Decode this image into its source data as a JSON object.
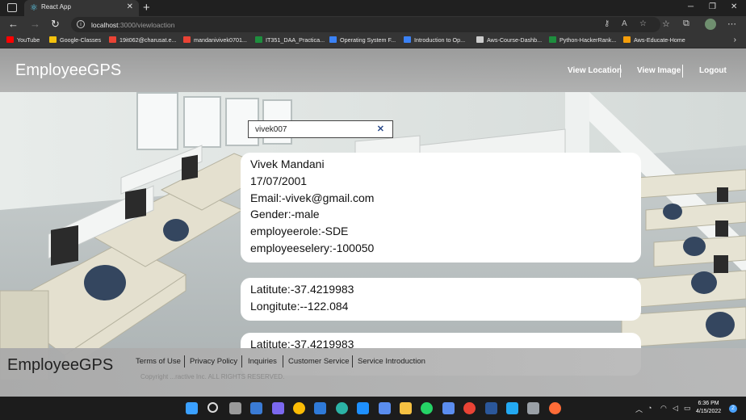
{
  "browser": {
    "tab_title": "React App",
    "url_host": "localhost",
    "url_path": ":3000/viewloaction",
    "bookmarks": [
      {
        "label": "YouTube",
        "color": "#ff0000"
      },
      {
        "label": "Google-Classes",
        "color": "#f4c20d"
      },
      {
        "label": "19it062@charusat.e...",
        "color": "#ea4335"
      },
      {
        "label": "mandanivivek0701...",
        "color": "#ea4335"
      },
      {
        "label": "IT351_DAA_Practica...",
        "color": "#1e8e3e"
      },
      {
        "label": "Operating System F...",
        "color": "#3b82f6"
      },
      {
        "label": "Introduction to Op...",
        "color": "#3b82f6"
      },
      {
        "label": "Aws-Course-Dashb...",
        "color": "#cccccc"
      },
      {
        "label": "Python-HackerRank...",
        "color": "#1e8e3e"
      },
      {
        "label": "Aws-Educate-Home",
        "color": "#f59e0b"
      }
    ]
  },
  "header": {
    "brand": "EmployeeGPS",
    "nav": [
      "View Location",
      "View Image",
      "Logout"
    ]
  },
  "search": {
    "value": "vivek007"
  },
  "employee_card": {
    "lines": [
      "Vivek Mandani",
      "17/07/2001",
      "Email:-vivek@gmail.com",
      "Gender:-male",
      "employeerole:-SDE",
      "employeeselery:-100050"
    ]
  },
  "location_cards": [
    {
      "latitude": "Latitute:-37.4219983",
      "longitude": "Longitute:--122.084"
    },
    {
      "latitude": "Latitute:-37.4219983",
      "longitude": ""
    }
  ],
  "footer": {
    "brand": "EmployeeGPS",
    "links": [
      "Terms of Use",
      "Privacy Policy",
      "Inquiries",
      "Customer Service",
      "Service Introduction"
    ],
    "copyright": "Copyright ...ractive Inc. ALL RIGHTS RESERVED."
  },
  "taskbar": {
    "time": "6:36 PM",
    "date": "4/15/2022",
    "notification_count": "2",
    "apps": [
      {
        "name": "windows-start",
        "color": "#3aa0ff"
      },
      {
        "name": "search",
        "color": "#dddddd"
      },
      {
        "name": "task-view",
        "color": "#aaaaaa"
      },
      {
        "name": "widgets",
        "color": "#3a7bd5"
      },
      {
        "name": "teams-chat",
        "color": "#7b68ee"
      },
      {
        "name": "chrome",
        "color": "#fbbc05"
      },
      {
        "name": "mail",
        "color": "#2f7ad8"
      },
      {
        "name": "edge",
        "color": "#2bb3a6"
      },
      {
        "name": "monitor-app",
        "color": "#1e90ff"
      },
      {
        "name": "store",
        "color": "#5a8dee"
      },
      {
        "name": "file-explorer",
        "color": "#f6c142"
      },
      {
        "name": "whatsapp",
        "color": "#25d366"
      },
      {
        "name": "snipping-tool",
        "color": "#5b8def"
      },
      {
        "name": "chrome-2",
        "color": "#ea4335"
      },
      {
        "name": "word",
        "color": "#2b579a"
      },
      {
        "name": "vscode",
        "color": "#23a9f2"
      },
      {
        "name": "terminal-app",
        "color": "#9aa0a6"
      },
      {
        "name": "postman",
        "color": "#ff6c37"
      }
    ]
  }
}
